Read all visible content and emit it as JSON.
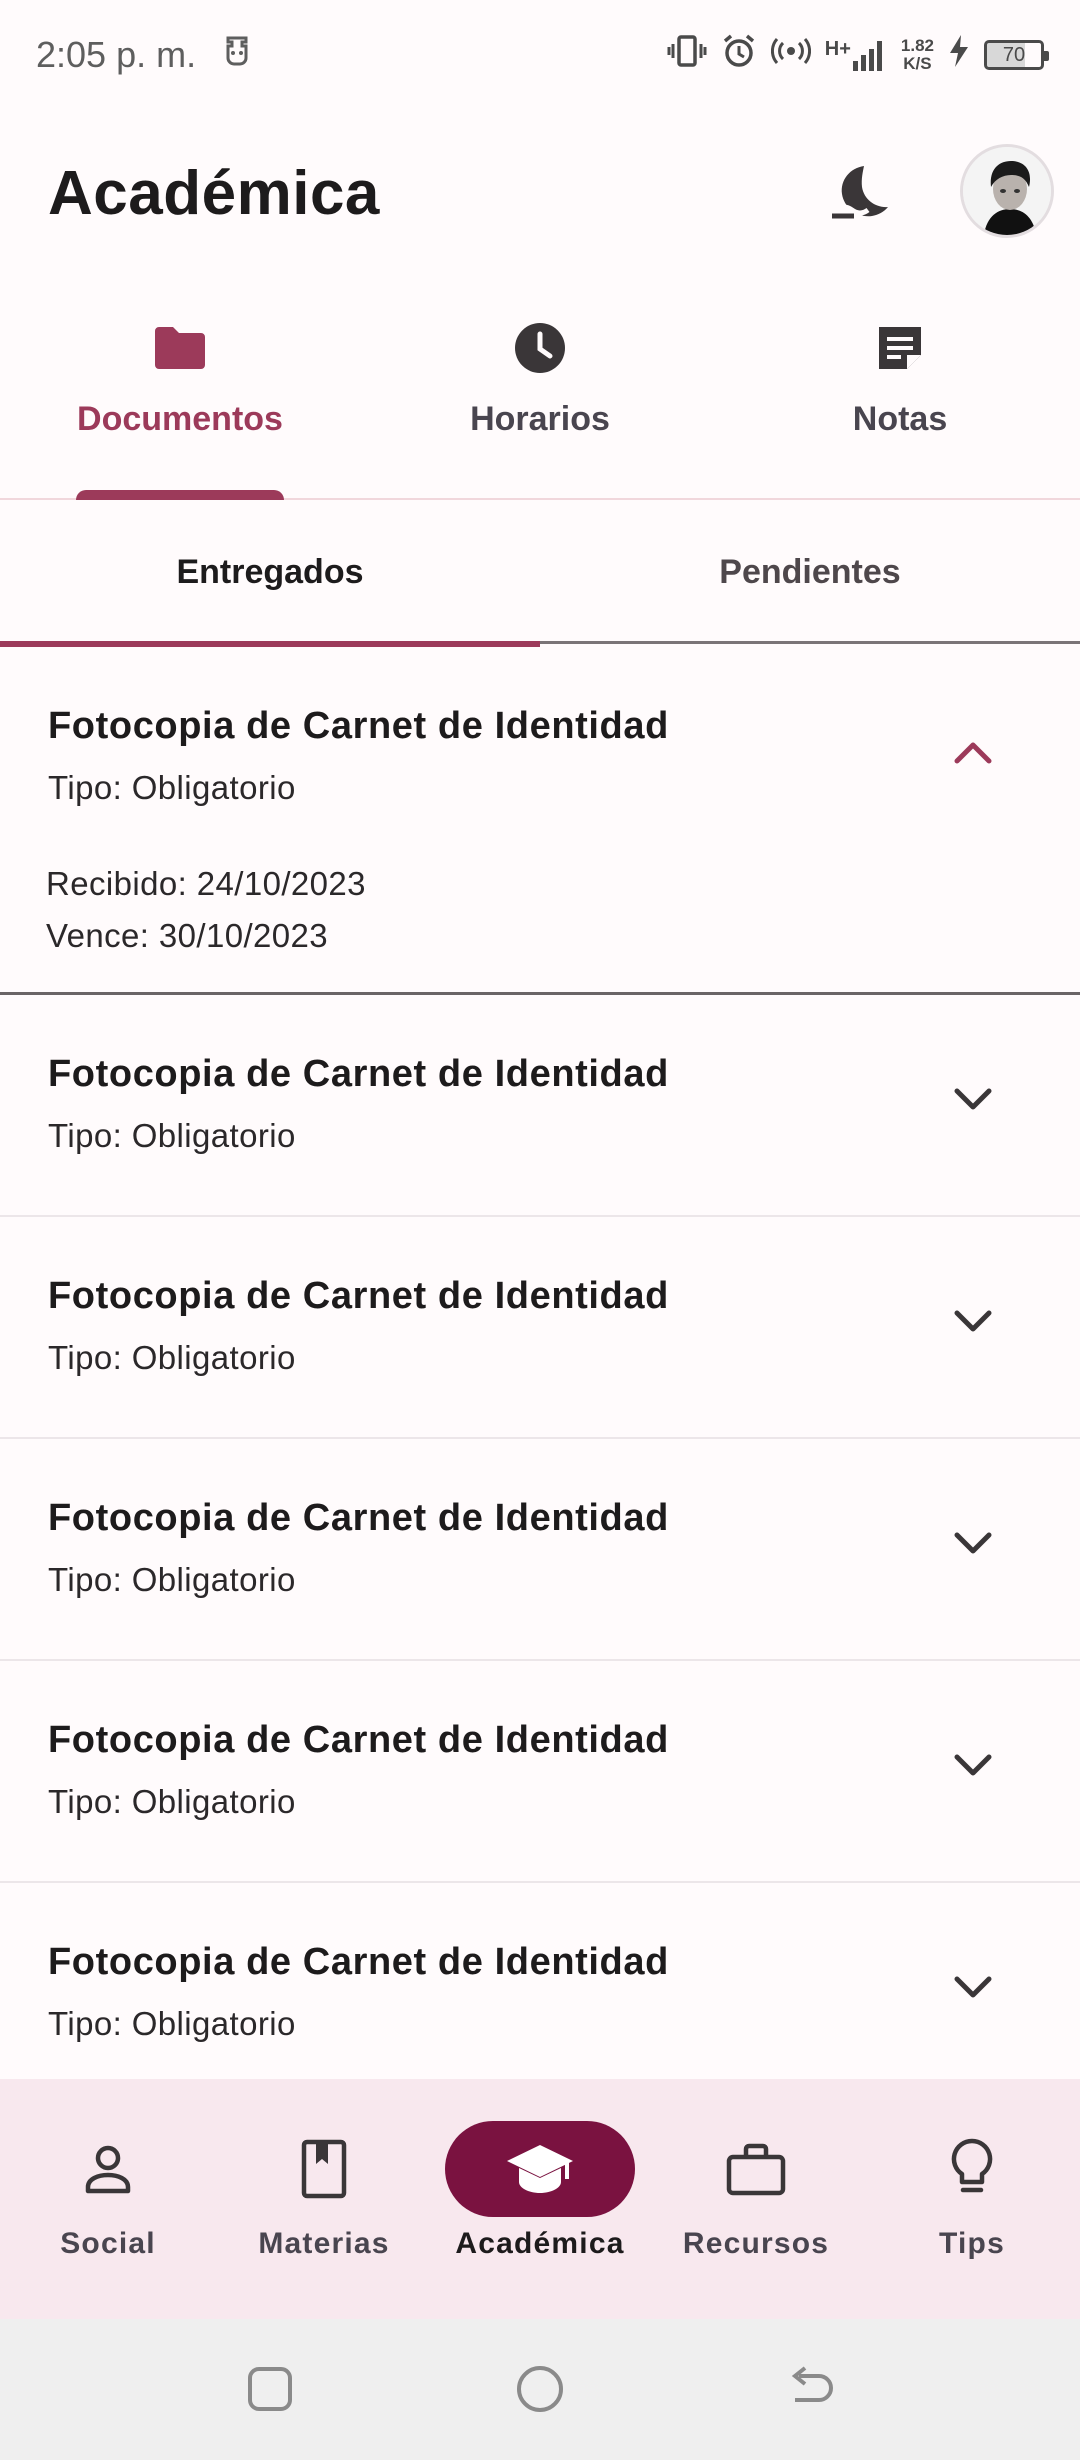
{
  "status_bar": {
    "time": "2:05 p. m.",
    "net_speed_value": "1.82",
    "net_speed_unit": "K/S",
    "network_label": "H+",
    "battery": "70"
  },
  "header": {
    "title": "Académica"
  },
  "top_tabs": [
    {
      "label": "Documentos",
      "icon": "folder-icon",
      "active": true
    },
    {
      "label": "Horarios",
      "icon": "clock-icon",
      "active": false
    },
    {
      "label": "Notas",
      "icon": "note-icon",
      "active": false
    }
  ],
  "sub_tabs": [
    {
      "label": "Entregados",
      "active": true
    },
    {
      "label": "Pendientes",
      "active": false
    }
  ],
  "documents": [
    {
      "title": "Fotocopia de Carnet de Identidad",
      "type": "Tipo: Obligatorio",
      "received": "Recibido: 24/10/2023",
      "due": "Vence: 30/10/2023",
      "expanded": true
    },
    {
      "title": "Fotocopia de Carnet de Identidad",
      "type": "Tipo: Obligatorio",
      "expanded": false
    },
    {
      "title": "Fotocopia de Carnet de Identidad",
      "type": "Tipo: Obligatorio",
      "expanded": false
    },
    {
      "title": "Fotocopia de Carnet de Identidad",
      "type": "Tipo: Obligatorio",
      "expanded": false
    },
    {
      "title": "Fotocopia de Carnet de Identidad",
      "type": "Tipo: Obligatorio",
      "expanded": false
    },
    {
      "title": "Fotocopia de Carnet de Identidad",
      "type": "Tipo: Obligatorio",
      "expanded": false
    }
  ],
  "bottom_nav": [
    {
      "label": "Social",
      "icon": "person-icon",
      "active": false
    },
    {
      "label": "Materias",
      "icon": "book-icon",
      "active": false
    },
    {
      "label": "Académica",
      "icon": "graduation-cap-icon",
      "active": true
    },
    {
      "label": "Recursos",
      "icon": "briefcase-icon",
      "active": false
    },
    {
      "label": "Tips",
      "icon": "lightbulb-icon",
      "active": false
    }
  ],
  "colors": {
    "accent": "#9c3a5a",
    "nav_active": "#7a1240",
    "nav_background": "#f8e8ee",
    "background": "#fffbfc"
  }
}
